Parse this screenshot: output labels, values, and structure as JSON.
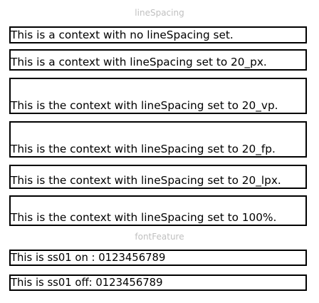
{
  "sections": {
    "line_spacing_title": "lineSpacing",
    "font_feature_title": "fontFeature"
  },
  "line_spacing_items": [
    "This is a context with no lineSpacing set.",
    "This is a context with lineSpacing set to 20_px.",
    "This is the context with lineSpacing set to 20_vp.",
    "This is the context with lineSpacing set to 20_fp.",
    "This is the context with lineSpacing set to 20_lpx.",
    "This is the context with lineSpacing set to 100%."
  ],
  "font_feature_items": [
    "This is ss01 on : 0123456789",
    "This is ss01 off: 0123456789"
  ]
}
